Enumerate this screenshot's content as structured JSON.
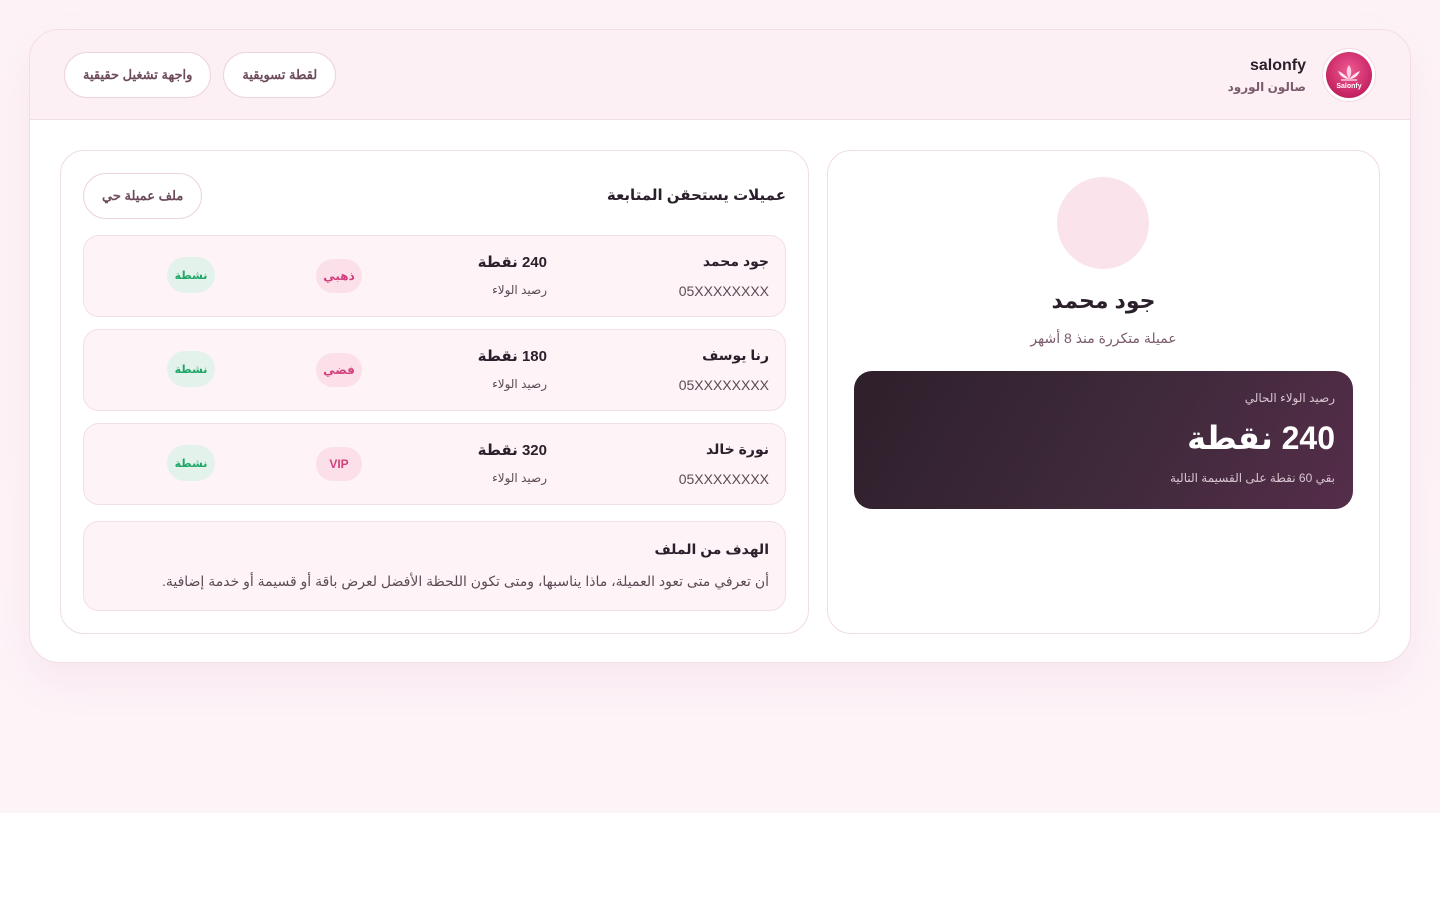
{
  "brand": {
    "name": "salonfy",
    "subtitle": "صالون الورود",
    "logo_text": "Salonfy"
  },
  "top_actions": {
    "live_ui": "واجهة تشغيل حقيقية",
    "marketing_shot": "لقطة تسويقية"
  },
  "profile": {
    "name": "جود محمد",
    "subtitle": "عميلة متكررة منذ 8 أشهر",
    "loyalty": {
      "label": "رصيد الولاء الحالي",
      "points": "240 نقطة",
      "note": "بقي 60 نقطة على القسيمة التالية"
    }
  },
  "followup": {
    "title": "عميلات يستحقن المتابعة",
    "live_profile_button": "ملف عميلة حي",
    "clients": [
      {
        "name": "جود محمد",
        "phone": "05XXXXXXXX",
        "points": "240 نقطة",
        "balance_label": "رصيد الولاء",
        "tier": "ذهبي",
        "status": "نشطة"
      },
      {
        "name": "رنا يوسف",
        "phone": "05XXXXXXXX",
        "points": "180 نقطة",
        "balance_label": "رصيد الولاء",
        "tier": "فضي",
        "status": "نشطة"
      },
      {
        "name": "نورة خالد",
        "phone": "05XXXXXXXX",
        "points": "320 نقطة",
        "balance_label": "رصيد الولاء",
        "tier": "VIP",
        "status": "نشطة"
      }
    ],
    "goal": {
      "title": "الهدف من الملف",
      "text": "أن تعرفي متى تعود العميلة، ماذا يناسبها، ومتى تكون اللحظة الأفضل لعرض باقة أو قسيمة أو خدمة إضافية."
    }
  },
  "colors": {
    "accent": "#d23f7d",
    "status_green": "#1ea667",
    "card_dark": "#2e1f2b"
  }
}
